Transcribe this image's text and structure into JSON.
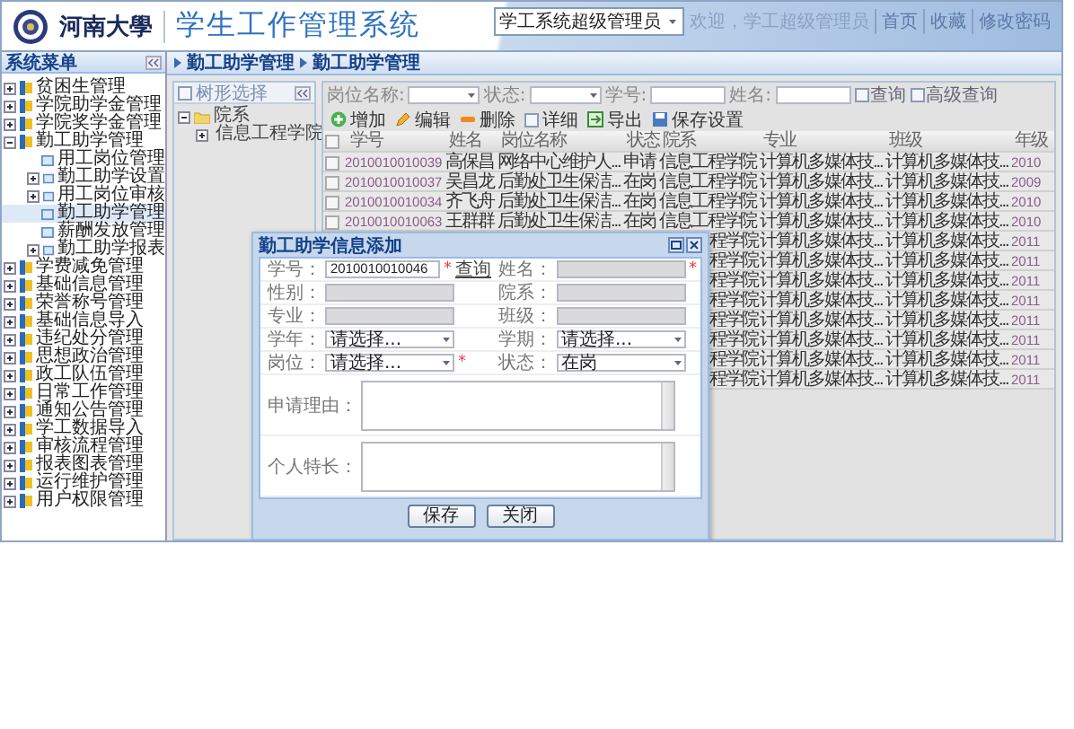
{
  "header": {
    "logo_text": "河南大學",
    "title": "学生工作管理系统",
    "role_select": "学工系统超级管理员",
    "welcome": "欢迎，学工超级管理员",
    "links": [
      "首页",
      "收藏",
      "修改密码"
    ]
  },
  "sidebar": {
    "title": "系统菜单",
    "items": [
      {
        "label": "贫困生管理",
        "expanded": false
      },
      {
        "label": "学院助学金管理",
        "expanded": false
      },
      {
        "label": "学院奖学金管理",
        "expanded": false
      },
      {
        "label": "勤工助学管理",
        "expanded": true,
        "children": [
          {
            "label": "用工岗位管理",
            "selected": false
          },
          {
            "label": "勤工助学设置",
            "expanded": false,
            "selected": false
          },
          {
            "label": "用工岗位审核",
            "expanded": false,
            "selected": false
          },
          {
            "label": "勤工助学管理",
            "selected": true
          },
          {
            "label": "薪酬发放管理",
            "selected": false
          },
          {
            "label": "勤工助学报表",
            "expanded": false,
            "selected": false
          }
        ]
      },
      {
        "label": "学费减免管理",
        "expanded": false
      },
      {
        "label": "基础信息管理",
        "expanded": false
      },
      {
        "label": "荣誉称号管理",
        "expanded": false
      },
      {
        "label": "基础信息导入",
        "expanded": false
      },
      {
        "label": "违纪处分管理",
        "expanded": false
      },
      {
        "label": "思想政治管理",
        "expanded": false
      },
      {
        "label": "政工队伍管理",
        "expanded": false
      },
      {
        "label": "日常工作管理",
        "expanded": false
      },
      {
        "label": "通知公告管理",
        "expanded": false
      },
      {
        "label": "学工数据导入",
        "expanded": false
      },
      {
        "label": "审核流程管理",
        "expanded": false
      },
      {
        "label": "报表图表管理",
        "expanded": false
      },
      {
        "label": "运行维护管理",
        "expanded": false
      },
      {
        "label": "用户权限管理",
        "expanded": false
      }
    ]
  },
  "breadcrumb": [
    "勤工助学管理",
    "勤工助学管理"
  ],
  "tree_panel": {
    "title": "树形选择",
    "nodes": [
      {
        "label": "院系",
        "expanded": true,
        "children": [
          {
            "label": "信息工程学院",
            "expanded": false
          }
        ]
      }
    ]
  },
  "filters": [
    {
      "label": "岗位名称:",
      "kind": "select"
    },
    {
      "label": "状态:",
      "kind": "select"
    },
    {
      "label": "学号:",
      "kind": "input"
    },
    {
      "label": "姓名:",
      "kind": "input"
    }
  ],
  "search_buttons": [
    "查询",
    "高级查询"
  ],
  "toolbar": [
    {
      "label": "增加",
      "kind": "add"
    },
    {
      "label": "编辑",
      "kind": "edit"
    },
    {
      "label": "删除",
      "kind": "delete"
    },
    {
      "label": "详细",
      "kind": "detail"
    },
    {
      "label": "导出",
      "kind": "export"
    },
    {
      "label": "保存设置",
      "kind": "save"
    }
  ],
  "table": {
    "all_checked": false,
    "columns": [
      "学号",
      "姓名",
      "岗位名称",
      "状态",
      "院系",
      "专业",
      "班级",
      "年级"
    ],
    "rows": [
      {
        "kind": "full",
        "checked": false,
        "id": "2010010010039",
        "name": "高保昌",
        "post": "网络中心维护人...",
        "status": "申请",
        "department": "信息工程学院",
        "major": "计算机多媒体技...",
        "class": "计算机多媒体技...",
        "year": "2010"
      },
      {
        "kind": "full",
        "checked": false,
        "id": "2010010010037",
        "name": "吴昌龙",
        "post": "后勤处卫生保洁...",
        "status": "在岗",
        "department": "信息工程学院",
        "major": "计算机多媒体技...",
        "class": "计算机多媒体技...",
        "year": "2009"
      },
      {
        "kind": "full",
        "checked": false,
        "id": "2010010010034",
        "name": "齐飞舟",
        "post": "后勤处卫生保洁...",
        "status": "在岗",
        "department": "信息工程学院",
        "major": "计算机多媒体技...",
        "class": "计算机多媒体技...",
        "year": "2010"
      },
      {
        "kind": "full",
        "checked": false,
        "id": "2010010010063",
        "name": "王群群",
        "post": "后勤处卫生保洁...",
        "status": "在岗",
        "department": "信息工程学院",
        "major": "计算机多媒体技...",
        "class": "计算机多媒体技...",
        "year": "2010"
      },
      {
        "kind": "covered",
        "department": "程学院",
        "major": "计算机多媒体技...",
        "class": "计算机多媒体技...",
        "year": "2011"
      },
      {
        "kind": "covered",
        "department": "程学院",
        "major": "计算机多媒体技...",
        "class": "计算机多媒体技...",
        "year": "2011"
      },
      {
        "kind": "covered",
        "department": "程学院",
        "major": "计算机多媒体技...",
        "class": "计算机多媒体技...",
        "year": "2011"
      },
      {
        "kind": "covered",
        "department": "程学院",
        "major": "计算机多媒体技...",
        "class": "计算机多媒体技...",
        "year": "2011"
      },
      {
        "kind": "covered",
        "department": "程学院",
        "major": "计算机多媒体技...",
        "class": "计算机多媒体技...",
        "year": "2011"
      },
      {
        "kind": "covered",
        "department": "程学院",
        "major": "计算机多媒体技...",
        "class": "计算机多媒体技...",
        "year": "2011"
      },
      {
        "kind": "covered",
        "department": "程学院",
        "major": "计算机多媒体技...",
        "class": "计算机多媒体技...",
        "year": "2011"
      },
      {
        "kind": "covered",
        "department": "程学院",
        "major": "计算机多媒体技...",
        "class": "计算机多媒体技...",
        "year": "2011"
      }
    ]
  },
  "dialog": {
    "title": "勤工助学信息添加",
    "required_mark": "*",
    "fields": [
      {
        "label": "学号：",
        "kind": "input",
        "value": "2010010010046",
        "required": true,
        "link": "查询"
      },
      {
        "label": "姓名：",
        "kind": "readonly",
        "required": true
      },
      {
        "label": "性别：",
        "kind": "readonly",
        "required": false
      },
      {
        "label": "院系：",
        "kind": "readonly",
        "required": false
      },
      {
        "label": "专业：",
        "kind": "readonly",
        "required": false
      },
      {
        "label": "班级：",
        "kind": "readonly",
        "required": false
      },
      {
        "label": "学年：",
        "kind": "select",
        "value": "请选择...",
        "required": false
      },
      {
        "label": "学期：",
        "kind": "select",
        "value": "请选择...",
        "required": false
      },
      {
        "label": "岗位：",
        "kind": "select",
        "value": "请选择...",
        "required": true
      },
      {
        "label": "状态：",
        "kind": "select",
        "value": "在岗",
        "required": false
      }
    ],
    "textareas": [
      {
        "label": "申请理由："
      },
      {
        "label": "个人特长："
      }
    ],
    "buttons": [
      "保存",
      "关闭"
    ]
  }
}
